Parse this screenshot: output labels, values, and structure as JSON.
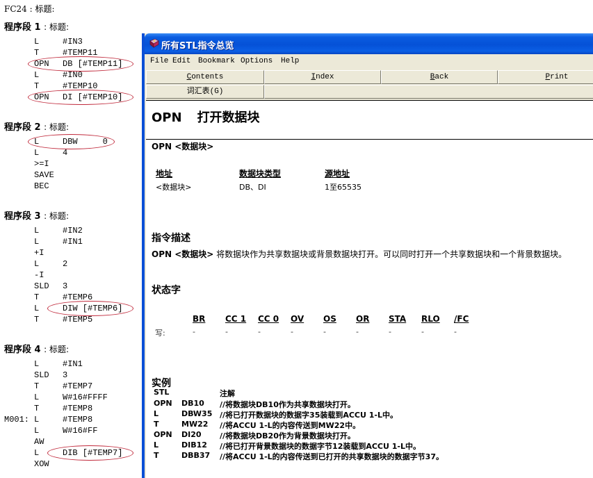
{
  "stl_editor": {
    "fc_title": "FC24 : 标题:",
    "segments": [
      {
        "title": "程序段 1",
        "subtitle": ": 标题:",
        "lines": [
          {
            "label": "",
            "op": "L",
            "arg": "#IN3",
            "highlighted": false
          },
          {
            "label": "",
            "op": "T",
            "arg": "#TEMP11",
            "highlighted": false
          },
          {
            "label": "",
            "op": "OPN",
            "arg": "DB [#TEMP11]",
            "highlighted": true
          },
          {
            "label": "",
            "op": "L",
            "arg": "#IN0",
            "highlighted": false
          },
          {
            "label": "",
            "op": "T",
            "arg": "#TEMP10",
            "highlighted": false
          },
          {
            "label": "",
            "op": "OPN",
            "arg": "DI [#TEMP10]",
            "highlighted": true
          }
        ]
      },
      {
        "title": "程序段 2",
        "subtitle": ": 标题:",
        "lines": [
          {
            "label": "",
            "op": "L",
            "arg": "DBW     0",
            "highlighted": true
          },
          {
            "label": "",
            "op": "L",
            "arg": "4",
            "highlighted": false
          },
          {
            "label": "",
            "op": ">=I",
            "arg": "",
            "highlighted": false
          },
          {
            "label": "",
            "op": "SAVE",
            "arg": "",
            "highlighted": false
          },
          {
            "label": "",
            "op": "BEC",
            "arg": "",
            "highlighted": false
          }
        ]
      },
      {
        "title": "程序段 3",
        "subtitle": ": 标题:",
        "lines": [
          {
            "label": "",
            "op": "L",
            "arg": "#IN2",
            "highlighted": false
          },
          {
            "label": "",
            "op": "L",
            "arg": "#IN1",
            "highlighted": false
          },
          {
            "label": "",
            "op": "+I",
            "arg": "",
            "highlighted": false
          },
          {
            "label": "",
            "op": "L",
            "arg": "2",
            "highlighted": false
          },
          {
            "label": "",
            "op": "-I",
            "arg": "",
            "highlighted": false
          },
          {
            "label": "",
            "op": "SLD",
            "arg": "3",
            "highlighted": false
          },
          {
            "label": "",
            "op": "T",
            "arg": "#TEMP6",
            "highlighted": false
          },
          {
            "label": "",
            "op": "L",
            "arg": "DIW [#TEMP6]",
            "highlighted": true
          },
          {
            "label": "",
            "op": "T",
            "arg": "#TEMP5",
            "highlighted": false
          }
        ]
      },
      {
        "title": "程序段 4",
        "subtitle": ": 标题:",
        "lines": [
          {
            "label": "",
            "op": "L",
            "arg": "#IN1",
            "highlighted": false
          },
          {
            "label": "",
            "op": "SLD",
            "arg": "3",
            "highlighted": false
          },
          {
            "label": "",
            "op": "T",
            "arg": "#TEMP7",
            "highlighted": false
          },
          {
            "label": "",
            "op": "L",
            "arg": "W#16#FFFF",
            "highlighted": false
          },
          {
            "label": "",
            "op": "T",
            "arg": "#TEMP8",
            "highlighted": false
          },
          {
            "label": "M001:",
            "op": "L",
            "arg": "#TEMP8",
            "highlighted": false
          },
          {
            "label": "",
            "op": "L",
            "arg": "W#16#FF",
            "highlighted": false
          },
          {
            "label": "",
            "op": "AW",
            "arg": "",
            "highlighted": false
          },
          {
            "label": "",
            "op": "L",
            "arg": "DIB [#TEMP7]",
            "highlighted": true
          },
          {
            "label": "",
            "op": "XOW",
            "arg": "",
            "highlighted": false
          }
        ]
      }
    ],
    "highlight_color": "#c0293b"
  },
  "help_window": {
    "title": "所有STL指令总览",
    "icon": "book-icon",
    "menu": [
      "File",
      "Edit",
      "Bookmark",
      "Options",
      "Help"
    ],
    "nav_buttons": [
      {
        "label": "Contents",
        "accel": "C"
      },
      {
        "label": "Index",
        "accel": "I"
      },
      {
        "label": "Back",
        "accel": "B"
      },
      {
        "label": "Print",
        "accel": "P"
      }
    ],
    "glossary_button": "词汇表(G)",
    "topic": {
      "mnemonic": "OPN",
      "name": "打开数据块",
      "syntax": "OPN <数据块>",
      "operand_table": {
        "headers": [
          "地址",
          "数据块类型",
          "源地址"
        ],
        "values": [
          "<数据块>",
          "DB、DI",
          "1至65535"
        ]
      },
      "description_heading": "指令描述",
      "description_bold": "OPN <数据块>",
      "description_text": " 将数据块作为共享数据块或背景数据块打开。可以同时打开一个共享数据块和一个背景数据块。",
      "status_word_heading": "状态字",
      "status_word": {
        "row_label": "写:",
        "bits": [
          "BR",
          "CC 1",
          "CC 0",
          "OV",
          "OS",
          "OR",
          "STA",
          "RLO",
          "/FC"
        ],
        "values": [
          "-",
          "-",
          "-",
          "-",
          "-",
          "-",
          "-",
          "-",
          "-"
        ]
      },
      "example_heading": "实例",
      "example_headers": [
        "STL",
        "注解"
      ],
      "examples": [
        {
          "op": "OPN",
          "arg": "DB10",
          "comment": "//将数据块DB10作为共享数据块打开。"
        },
        {
          "op": "L",
          "arg": "DBW35",
          "comment": "//将已打开数据块的数据字35装载到ACCU 1-L中。"
        },
        {
          "op": "T",
          "arg": "MW22",
          "comment": "//将ACCU 1-L的内容传送到MW22中。"
        },
        {
          "op": "OPN",
          "arg": "DI20",
          "comment": "//将数据块DB20作为背景数据块打开。"
        },
        {
          "op": "L",
          "arg": "DIB12",
          "comment": "//将已打开背景数据块的数据字节12装载到ACCU 1-L中。"
        },
        {
          "op": "T",
          "arg": "DBB37",
          "comment": "//将ACCU 1-L的内容传送到已打开的共享数据块的数据字节37。"
        }
      ]
    }
  }
}
